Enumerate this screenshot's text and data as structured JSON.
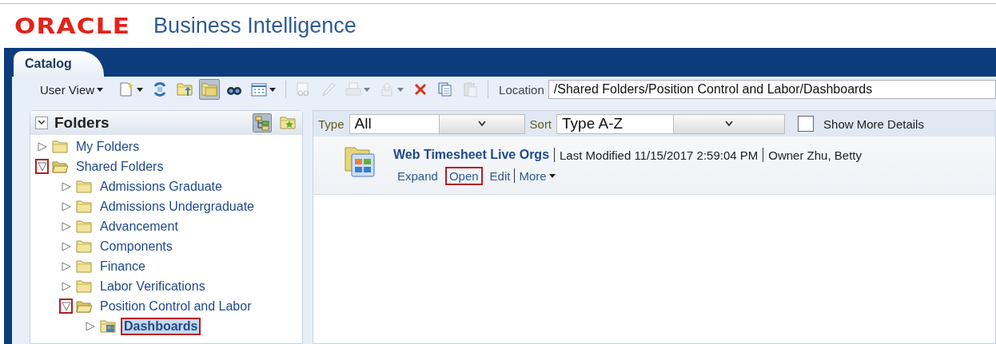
{
  "header": {
    "brand": "ORACLE",
    "product": "Business Intelligence"
  },
  "tabs": [
    {
      "label": "Catalog",
      "selected": true
    }
  ],
  "toolbar": {
    "view_menu": "User View",
    "items": [
      {
        "kind": "new",
        "disabled": false,
        "dropdown": true
      },
      {
        "kind": "refresh",
        "disabled": false,
        "dropdown": false
      },
      {
        "kind": "upload",
        "disabled": false,
        "dropdown": false
      },
      {
        "kind": "folders",
        "disabled": false,
        "dropdown": false,
        "selected": true
      },
      {
        "kind": "search",
        "disabled": false,
        "dropdown": false
      },
      {
        "kind": "grid",
        "disabled": false,
        "dropdown": true
      },
      {
        "kind": "separator"
      },
      {
        "kind": "view",
        "disabled": true,
        "dropdown": false
      },
      {
        "kind": "edit",
        "disabled": true,
        "dropdown": false
      },
      {
        "kind": "print",
        "disabled": true,
        "dropdown": true
      },
      {
        "kind": "export",
        "disabled": true,
        "dropdown": true
      },
      {
        "kind": "delete",
        "disabled": false,
        "dropdown": false
      },
      {
        "kind": "copy",
        "disabled": false,
        "dropdown": false
      },
      {
        "kind": "paste",
        "disabled": true,
        "dropdown": false
      },
      {
        "kind": "separator"
      }
    ],
    "location_label": "Location",
    "location": "/Shared Folders/Position Control and Labor/Dashboards"
  },
  "folders": {
    "title": "Folders",
    "tree": [
      {
        "label": "My Folders",
        "kind": "folder",
        "expanded": false,
        "selected": false
      },
      {
        "label": "Shared Folders",
        "kind": "folder",
        "expanded": true,
        "selected": false,
        "highlighted_toggle": true,
        "children": [
          {
            "label": "Admissions Graduate",
            "kind": "folder",
            "expanded": false,
            "selected": false
          },
          {
            "label": "Admissions Undergraduate",
            "kind": "folder",
            "expanded": false,
            "selected": false
          },
          {
            "label": "Advancement",
            "kind": "folder",
            "expanded": false,
            "selected": false
          },
          {
            "label": "Components",
            "kind": "folder",
            "expanded": false,
            "selected": false
          },
          {
            "label": "Finance",
            "kind": "folder",
            "expanded": false,
            "selected": false
          },
          {
            "label": "Labor Verifications",
            "kind": "folder",
            "expanded": false,
            "selected": false
          },
          {
            "label": "Position Control and Labor",
            "kind": "folder",
            "expanded": true,
            "selected": false,
            "highlighted_toggle": true,
            "children": [
              {
                "label": "Dashboards",
                "kind": "dashboards",
                "expanded": false,
                "selected": true,
                "highlighted": true
              }
            ]
          }
        ]
      }
    ]
  },
  "filter": {
    "type_label": "Type",
    "type_value": "All",
    "sort_label": "Sort",
    "sort_value": "Type A-Z",
    "details_label": "Show More Details",
    "details_checked": false
  },
  "results": [
    {
      "title": "Web Timesheet Live Orgs",
      "modified": "Last Modified 11/15/2017 2:59:04 PM",
      "owner": "Owner Zhu, Betty",
      "actions": [
        {
          "label": "Expand",
          "highlighted": false,
          "dropdown": false
        },
        {
          "label": "Open",
          "highlighted": true,
          "dropdown": false
        },
        {
          "label": "Edit",
          "highlighted": false,
          "dropdown": false
        },
        {
          "label": "More",
          "highlighted": false,
          "dropdown": true
        }
      ]
    }
  ]
}
